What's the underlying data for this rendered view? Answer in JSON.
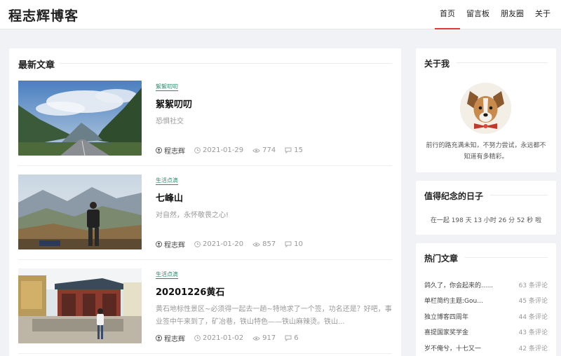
{
  "header": {
    "logo": "程志辉博客",
    "nav": [
      {
        "label": "首页",
        "active": true
      },
      {
        "label": "留言板",
        "active": false
      },
      {
        "label": "朋友圈",
        "active": false
      },
      {
        "label": "关于",
        "active": false
      }
    ]
  },
  "main": {
    "section_title": "最新文章",
    "articles": [
      {
        "tag": "絮絮叨叨",
        "title": "絮絮叨叨",
        "excerpt": "恐惧社交",
        "author": "程志辉",
        "date": "2021-01-29",
        "views": "774",
        "comments": "15"
      },
      {
        "tag": "生活点滴",
        "title": "七峰山",
        "excerpt": "对自然，永怀敬畏之心!",
        "author": "程志辉",
        "date": "2021-01-20",
        "views": "857",
        "comments": "10"
      },
      {
        "tag": "生活点滴",
        "title": "20201226黄石",
        "excerpt": "黄石地标性景区~必须得一起去一趟~特地求了一个签，功名还是？好吧，事业签中午来到了，矿冶巷，铁山特色——铁山麻辣烫。铁山...",
        "author": "程志辉",
        "date": "2021-01-02",
        "views": "917",
        "comments": "6"
      }
    ]
  },
  "sidebar": {
    "about": {
      "title": "关于我",
      "text": "前行的路充满未知，不努力尝试，永远都不知道有多精彩。"
    },
    "days": {
      "title": "值得纪念的日子",
      "text": "在一起 198 天 13 小时 26 分 52 秒 啦"
    },
    "hot": {
      "title": "热门文章",
      "items": [
        {
          "title": "鸽久了，你会起来的......",
          "count": "63 条评论"
        },
        {
          "title": "单栏简约主题:Gou...",
          "count": "45 条评论"
        },
        {
          "title": "独立博客四周年",
          "count": "44 条评论"
        },
        {
          "title": "喜提国家奖学金",
          "count": "43 条评论"
        },
        {
          "title": "岁不俺兮，十七又一",
          "count": "42 条评论"
        }
      ]
    }
  },
  "colors": {
    "accent": "#e4393c",
    "tag": "#2a8a6a"
  }
}
